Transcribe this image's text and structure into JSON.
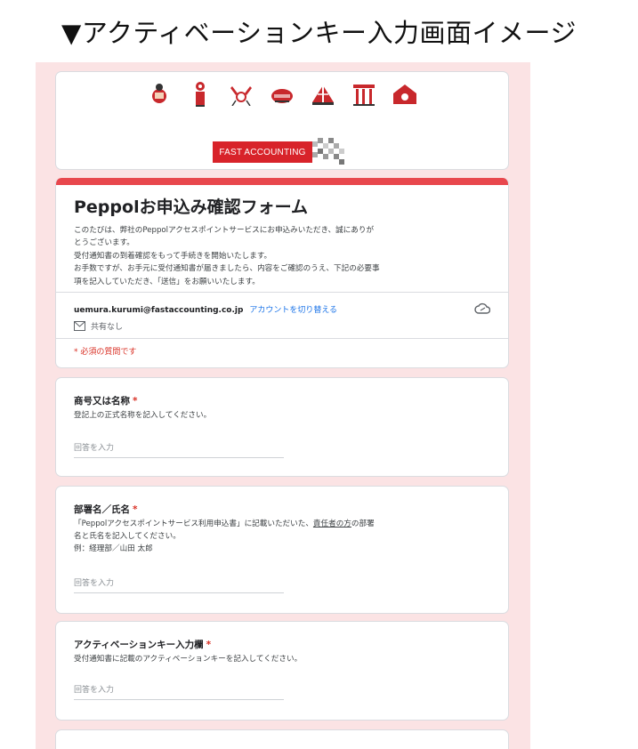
{
  "caption": "▼アクティベーションキー入力画面イメージ",
  "header": {
    "brand_label": "FAST ACCOUNTING",
    "mascots": [
      "daruma-mascot-icon",
      "lantern-mascot-icon",
      "crab-mascot-icon",
      "bun-mascot-icon",
      "tent-mascot-icon",
      "shrine-mascot-icon",
      "house-mascot-icon"
    ],
    "accent_color": "#d8232a"
  },
  "form": {
    "title": "Peppolお申込み確認フォーム",
    "description": [
      "このたびは、弊社のPeppolアクセスポイントサービスにお申込みいただき、誠にありが",
      "とうございます。",
      "受付通知書の到着確認をもって手続きを開始いたします。",
      "お手数ですが、お手元に受付通知書が届きましたら、内容をご確認のうえ、下記の必要事",
      "項を記入していただき、「送信」をお願いいたします。"
    ],
    "account_email": "uemura.kurumi@fastaccounting.co.jp",
    "switch_account": "アカウントを切り替える",
    "share_status": "共有なし",
    "required_note": "* 必須の質問です",
    "bar_color": "#e8474d"
  },
  "questions": [
    {
      "title": "商号又は名称",
      "required_mark": "*",
      "help": [
        "登記上の正式名称を記入してください。"
      ],
      "placeholder": "回答を入力"
    },
    {
      "title": "部署名／氏名",
      "required_mark": "*",
      "help_line1_before": "「Peppolアクセスポイントサービス利用申込書」に記載いただいた、",
      "help_line1_underlined": "責任者の方",
      "help_line1_after": "の部署",
      "help_line2": "名と氏名を記入してください。",
      "help_line3": "例：経理部／山田 太郎",
      "placeholder": "回答を入力"
    },
    {
      "title": "アクティベーションキー入力欄",
      "required_mark": "*",
      "help": [
        "受付通知書に記載のアクティベーションキーを記入してください。"
      ],
      "placeholder": "回答を入力"
    }
  ]
}
